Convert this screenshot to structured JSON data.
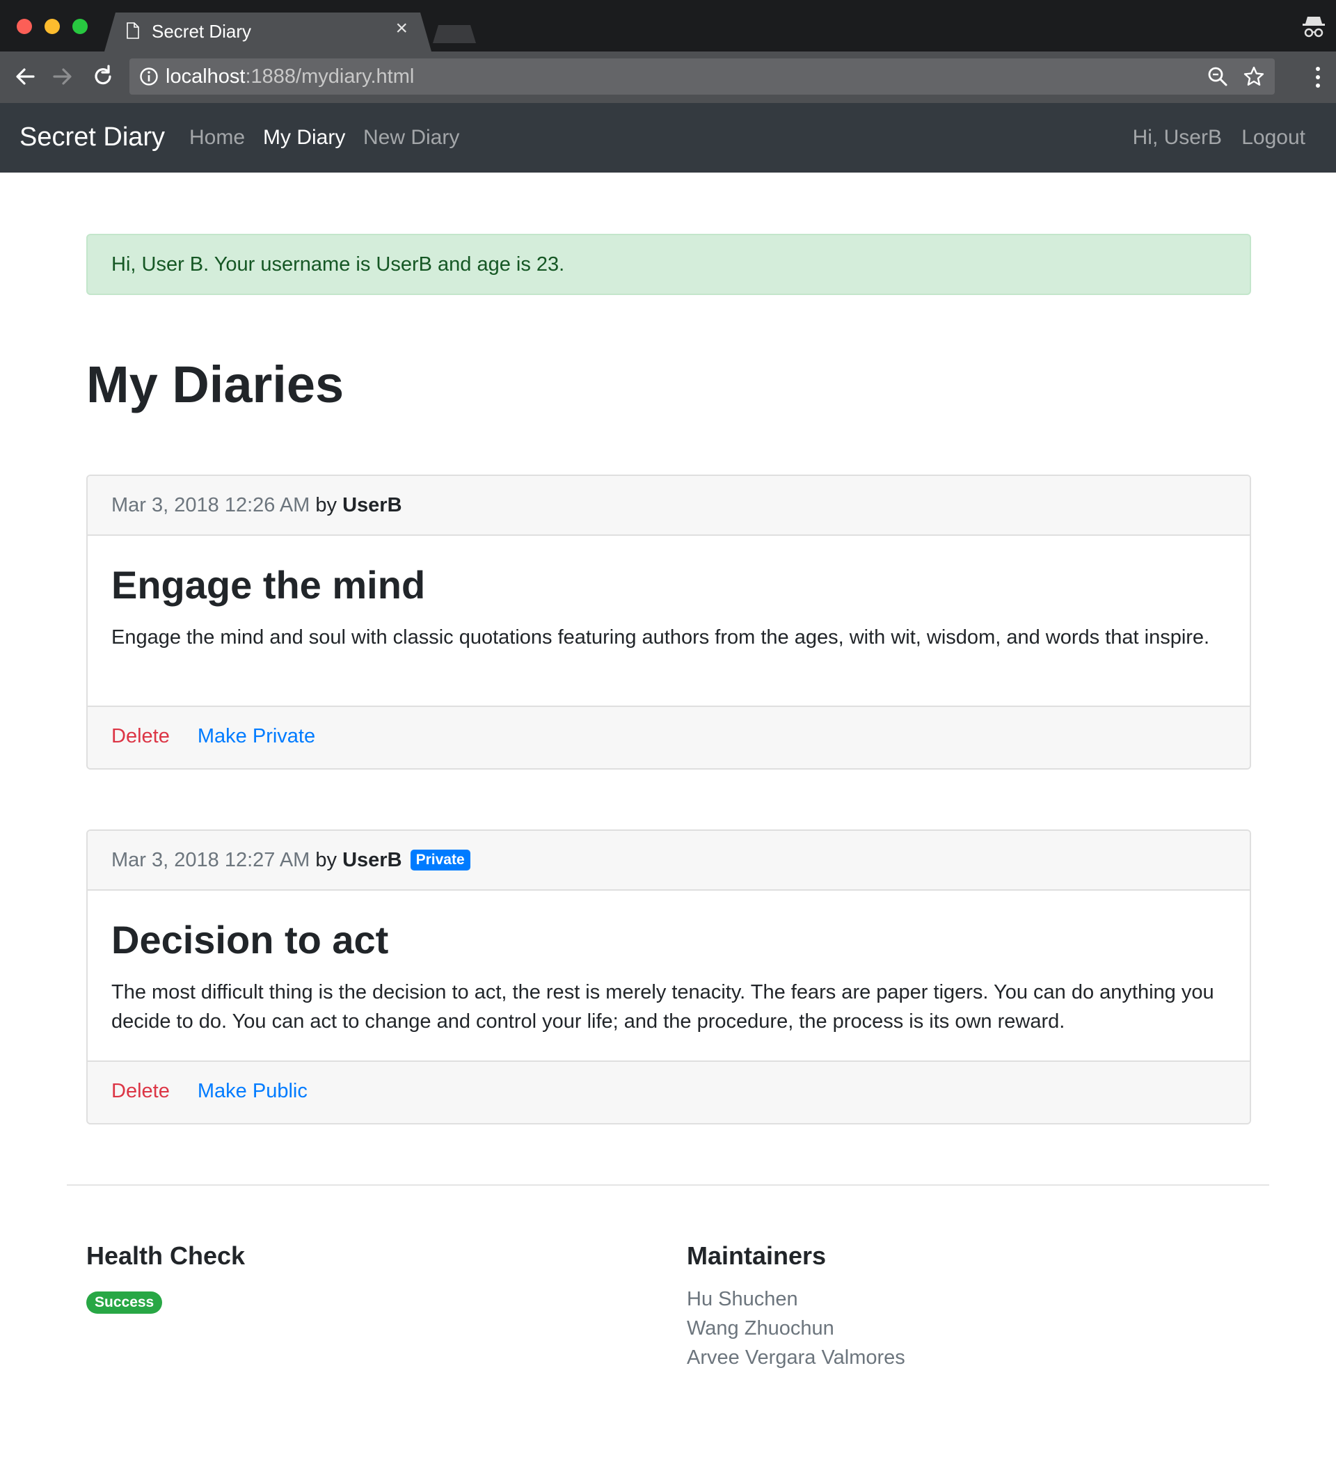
{
  "browser": {
    "tab_title": "Secret Diary",
    "tab_close": "×",
    "url_host": "localhost",
    "url_rest": ":1888/mydiary.html"
  },
  "navbar": {
    "brand": "Secret Diary",
    "links": {
      "home": "Home",
      "my_diary": "My Diary",
      "new_diary": "New Diary"
    },
    "user_greeting": "Hi, UserB",
    "logout": "Logout"
  },
  "alert": {
    "text": "Hi, User B. Your username is UserB and age is 23."
  },
  "page_title": "My Diaries",
  "diaries": [
    {
      "date": "Mar 3, 2018 12:26 AM",
      "by": "by",
      "author": "UserB",
      "title": "Engage the mind",
      "text": "Engage the mind and soul with classic quotations featuring authors from the ages, with wit, wisdom, and words that inspire.",
      "delete_label": "Delete",
      "toggle_label": "Make Private"
    },
    {
      "date": "Mar 3, 2018 12:27 AM",
      "by": "by",
      "author": "UserB",
      "badge": "Private",
      "title": "Decision to act",
      "text": "The most difficult thing is the decision to act, the rest is merely tenacity. The fears are paper tigers. You can do anything you decide to do. You can act to change and control your life; and the procedure, the process is its own reward.",
      "delete_label": "Delete",
      "toggle_label": "Make Public"
    }
  ],
  "footer": {
    "health_heading": "Health Check",
    "health_status": "Success",
    "maintainers_heading": "Maintainers",
    "maintainers": [
      "Hu Shuchen",
      "Wang Zhuochun",
      "Arvee Vergara Valmores"
    ]
  },
  "colors": {
    "navbar_bg": "#343a40",
    "alert_bg": "#d4edda",
    "alert_text": "#155724",
    "danger": "#dc3545",
    "primary": "#007bff",
    "success": "#28a745"
  },
  "icons": [
    "document-icon",
    "close-icon",
    "incognito-icon",
    "back-arrow-icon",
    "forward-arrow-icon",
    "reload-icon",
    "info-icon",
    "zoom-icon",
    "star-icon",
    "more-menu-icon"
  ]
}
